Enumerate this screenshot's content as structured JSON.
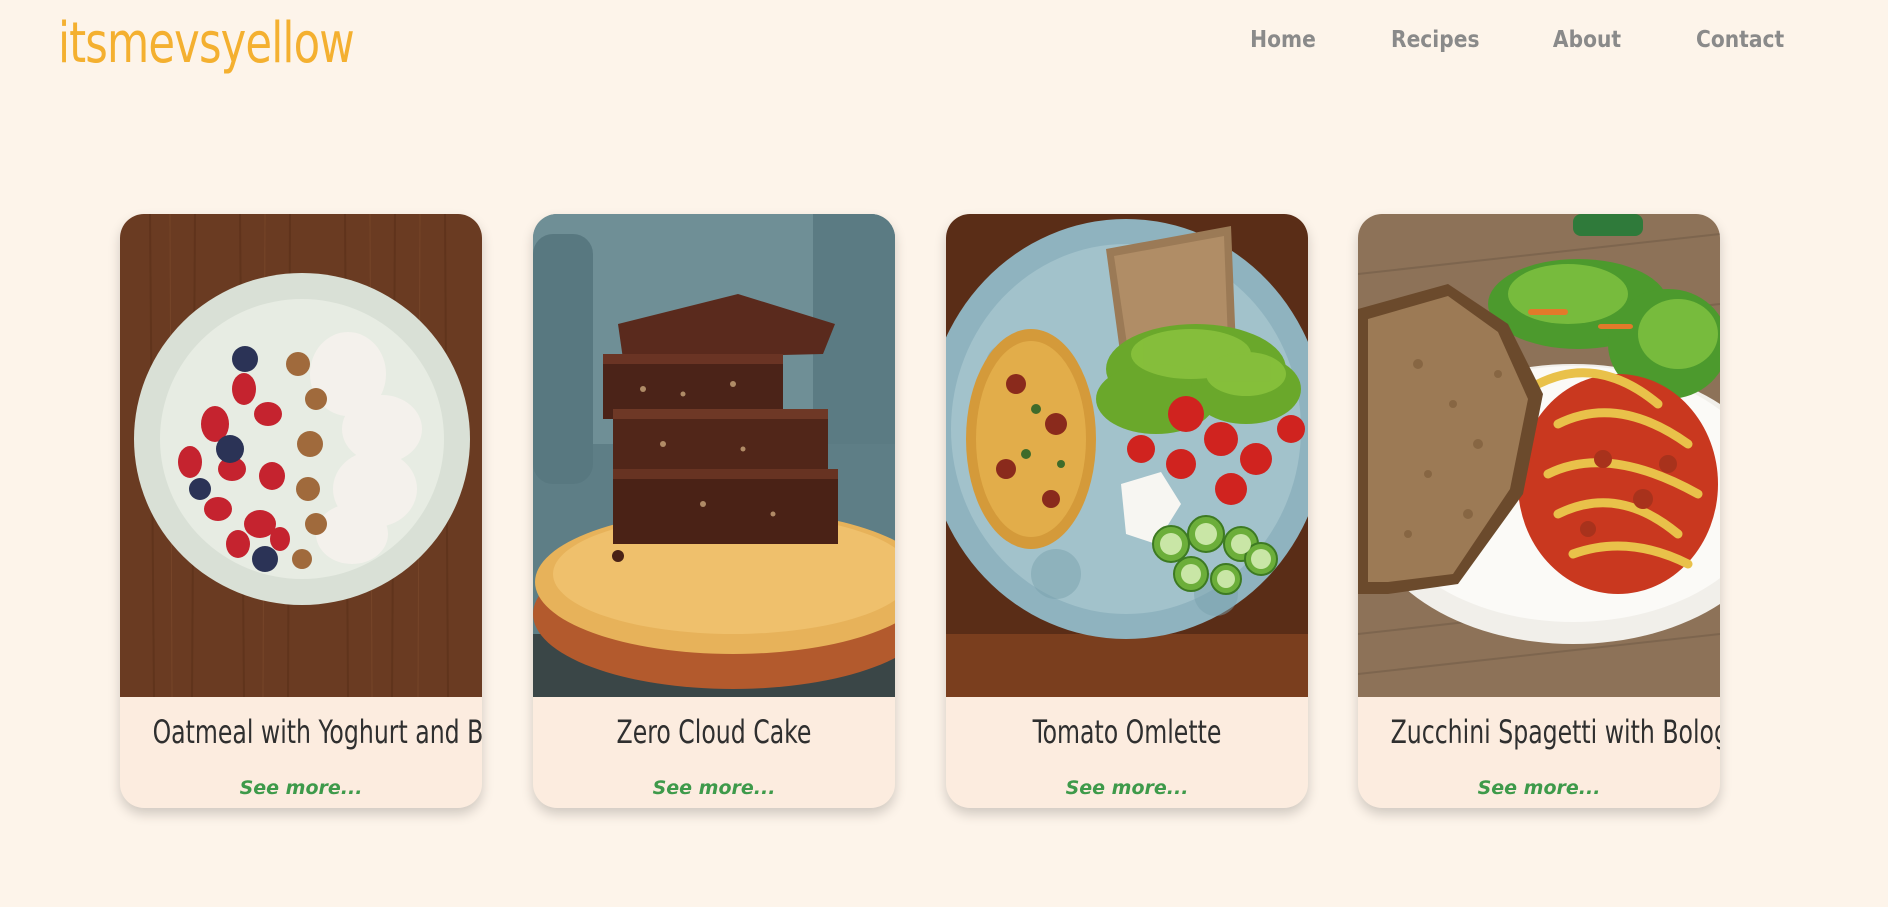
{
  "header": {
    "logo_text": "itsmevsyellow",
    "nav": [
      {
        "label": "Home"
      },
      {
        "label": "Recipes"
      },
      {
        "label": "About"
      },
      {
        "label": "Contact"
      }
    ]
  },
  "cards": [
    {
      "title": "Oatmeal with Yoghurt and Berries",
      "link_label": "See more..."
    },
    {
      "title": "Zero Cloud Cake",
      "link_label": "See more..."
    },
    {
      "title": "Tomato Omlette",
      "link_label": "See more..."
    },
    {
      "title": "Zucchini Spagetti with Bolognese",
      "link_label": "See more..."
    }
  ],
  "colors": {
    "background": "#fdf4ea",
    "logo": "#f4b030",
    "nav": "#8a8a8a",
    "card_background": "#fcecdf",
    "see_more": "#3e9a4a"
  }
}
